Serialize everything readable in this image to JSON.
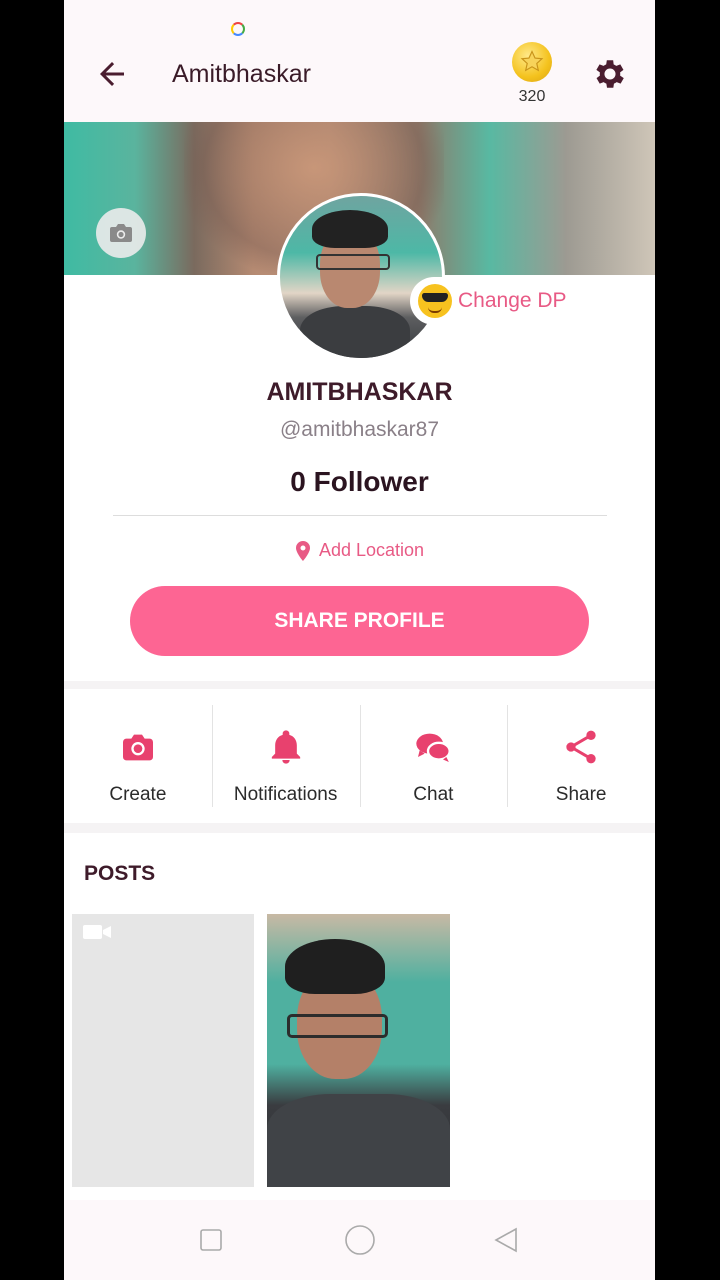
{
  "header": {
    "title": "Amitbhaskar",
    "coins": "320"
  },
  "profile": {
    "change_dp": "Change DP",
    "name": "AMITBHASKAR",
    "handle": "@amitbhaskar87",
    "followers": "0 Follower",
    "location": "Add Location",
    "share_button": "SHARE PROFILE"
  },
  "actions": [
    {
      "label": "Create",
      "icon": "camera-icon"
    },
    {
      "label": "Notifications",
      "icon": "bell-icon"
    },
    {
      "label": "Chat",
      "icon": "chat-icon"
    },
    {
      "label": "Share",
      "icon": "share-icon"
    }
  ],
  "posts": {
    "title": "POSTS"
  },
  "colors": {
    "accent": "#fd6593",
    "accent_text": "#e85a85",
    "title_dark": "#3e1b2a"
  }
}
